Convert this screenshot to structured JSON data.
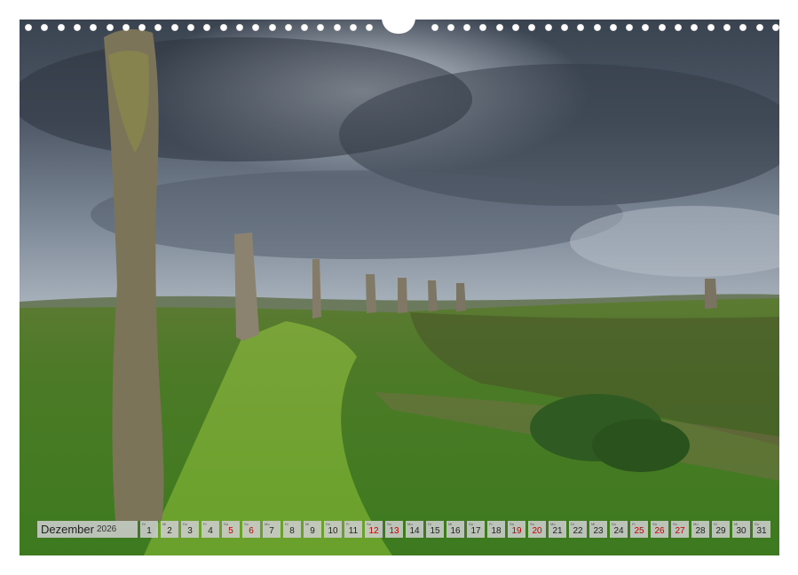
{
  "calendar": {
    "month": "Dezember",
    "year": "2026",
    "days": [
      {
        "n": "1",
        "wd": "Di",
        "we": false
      },
      {
        "n": "2",
        "wd": "Mi",
        "we": false
      },
      {
        "n": "3",
        "wd": "Do",
        "we": false
      },
      {
        "n": "4",
        "wd": "Fr",
        "we": false
      },
      {
        "n": "5",
        "wd": "Sa",
        "we": true
      },
      {
        "n": "6",
        "wd": "So",
        "we": true
      },
      {
        "n": "7",
        "wd": "Mo",
        "we": false
      },
      {
        "n": "8",
        "wd": "Di",
        "we": false
      },
      {
        "n": "9",
        "wd": "Mi",
        "we": false
      },
      {
        "n": "10",
        "wd": "Do",
        "we": false
      },
      {
        "n": "11",
        "wd": "Fr",
        "we": false
      },
      {
        "n": "12",
        "wd": "Sa",
        "we": true
      },
      {
        "n": "13",
        "wd": "So",
        "we": true
      },
      {
        "n": "14",
        "wd": "Mo",
        "we": false
      },
      {
        "n": "15",
        "wd": "Di",
        "we": false
      },
      {
        "n": "16",
        "wd": "Mi",
        "we": false
      },
      {
        "n": "17",
        "wd": "Do",
        "we": false
      },
      {
        "n": "18",
        "wd": "Fr",
        "we": false
      },
      {
        "n": "19",
        "wd": "Sa",
        "we": true
      },
      {
        "n": "20",
        "wd": "So",
        "we": true
      },
      {
        "n": "21",
        "wd": "Mo",
        "we": false
      },
      {
        "n": "22",
        "wd": "Di",
        "we": false
      },
      {
        "n": "23",
        "wd": "Mi",
        "we": false
      },
      {
        "n": "24",
        "wd": "Do",
        "we": false
      },
      {
        "n": "25",
        "wd": "Fr",
        "we": true
      },
      {
        "n": "26",
        "wd": "Sa",
        "we": true
      },
      {
        "n": "27",
        "wd": "So",
        "we": true
      },
      {
        "n": "28",
        "wd": "Mo",
        "we": false
      },
      {
        "n": "29",
        "wd": "Di",
        "we": false
      },
      {
        "n": "30",
        "wd": "Mi",
        "we": false
      },
      {
        "n": "31",
        "wd": "Do",
        "we": false
      }
    ]
  },
  "colors": {
    "weekend": "#c00000",
    "sky_dark": "#3d4652",
    "grass": "#4f8a2a"
  }
}
